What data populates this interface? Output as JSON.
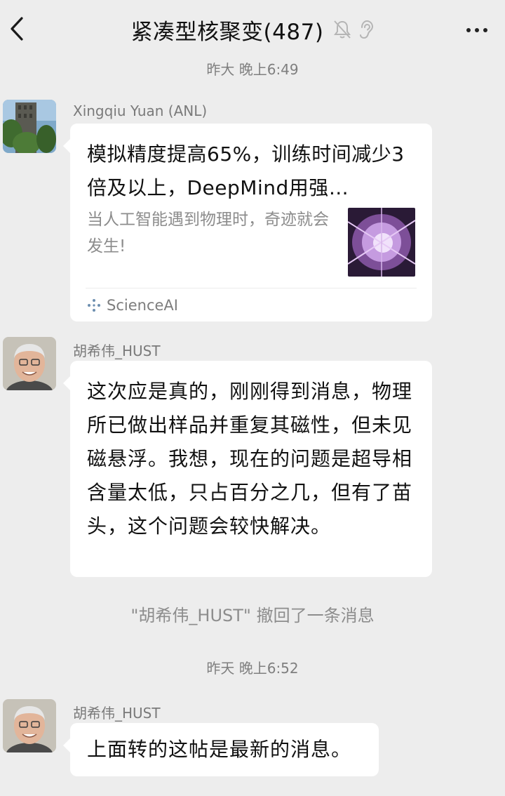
{
  "header": {
    "title": "紧凑型核聚变(487)",
    "icons": [
      "back-arrow-icon",
      "mute-bell-icon",
      "ear-icon",
      "more-dots-icon"
    ]
  },
  "messages": {
    "ts1": "昨大 晚上6:49",
    "m1": {
      "sender": "Xingqiu Yuan (ANL)",
      "card_title": "模拟精度提高65%，训练时间减少3倍及以上，DeepMind用强…",
      "card_desc": "当人工智能遇到物理时，奇迹就会发生!",
      "card_source": "ScienceAI"
    },
    "m2": {
      "sender": "胡希伟_HUST",
      "text": "这次应是真的，刚刚得到消息，物理所已做出样品并重复其磁性，但未见磁悬浮。我想，现在的问题是超导相含量太低，只占百分之几，但有了苗头，这个问题会较快解决。"
    },
    "recall": "\"胡希伟_HUST\" 撤回了一条消息",
    "ts2": "昨天 晚上6:52",
    "m3": {
      "sender": "胡希伟_HUST",
      "text": "上面转的这帖是最新的消息。"
    }
  },
  "colors": {
    "background": "#ededed",
    "bubble": "#ffffff",
    "meta_text": "#7f7f7f"
  }
}
